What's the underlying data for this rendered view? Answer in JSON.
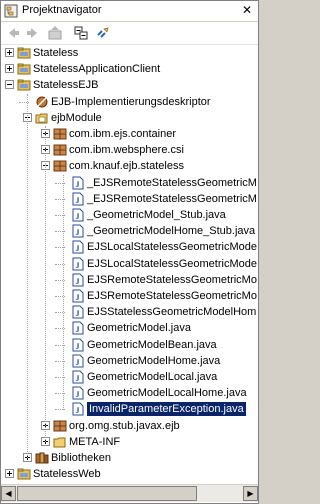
{
  "window": {
    "title": "Projektnavigator",
    "close_glyph": "✕"
  },
  "toolbar": {
    "buttons": [
      "back-arrow-icon",
      "forward-arrow-icon",
      "up-folder-icon",
      "collapse-all-icon",
      "link-editor-icon"
    ]
  },
  "tree": {
    "items": [
      {
        "label": "Stateless",
        "depth": 0,
        "expander": "plus",
        "icon": "project"
      },
      {
        "label": "StatelessApplicationClient",
        "depth": 0,
        "expander": "plus",
        "icon": "project"
      },
      {
        "label": "StatelessEJB",
        "depth": 0,
        "expander": "minus",
        "icon": "project"
      },
      {
        "label": "EJB-Implementierungsdeskriptor",
        "depth": 1,
        "expander": "none",
        "icon": "descriptor"
      },
      {
        "label": "ejbModule",
        "depth": 1,
        "expander": "minus",
        "icon": "source-folder"
      },
      {
        "label": "com.ibm.ejs.container",
        "depth": 2,
        "expander": "plus",
        "icon": "package"
      },
      {
        "label": "com.ibm.websphere.csi",
        "depth": 2,
        "expander": "plus",
        "icon": "package"
      },
      {
        "label": "com.knauf.ejb.stateless",
        "depth": 2,
        "expander": "minus",
        "icon": "package"
      },
      {
        "label": "_EJSRemoteStatelessGeometricM",
        "depth": 3,
        "expander": "none",
        "icon": "java"
      },
      {
        "label": "_EJSRemoteStatelessGeometricM",
        "depth": 3,
        "expander": "none",
        "icon": "java"
      },
      {
        "label": "_GeometricModel_Stub.java",
        "depth": 3,
        "expander": "none",
        "icon": "java"
      },
      {
        "label": "_GeometricModelHome_Stub.java",
        "depth": 3,
        "expander": "none",
        "icon": "java"
      },
      {
        "label": "EJSLocalStatelessGeometricMode",
        "depth": 3,
        "expander": "none",
        "icon": "java"
      },
      {
        "label": "EJSLocalStatelessGeometricMode",
        "depth": 3,
        "expander": "none",
        "icon": "java"
      },
      {
        "label": "EJSRemoteStatelessGeometricMo",
        "depth": 3,
        "expander": "none",
        "icon": "java"
      },
      {
        "label": "EJSRemoteStatelessGeometricMo",
        "depth": 3,
        "expander": "none",
        "icon": "java"
      },
      {
        "label": "EJSStatelessGeometricModelHom",
        "depth": 3,
        "expander": "none",
        "icon": "java"
      },
      {
        "label": "GeometricModel.java",
        "depth": 3,
        "expander": "none",
        "icon": "java"
      },
      {
        "label": "GeometricModelBean.java",
        "depth": 3,
        "expander": "none",
        "icon": "java"
      },
      {
        "label": "GeometricModelHome.java",
        "depth": 3,
        "expander": "none",
        "icon": "java"
      },
      {
        "label": "GeometricModelLocal.java",
        "depth": 3,
        "expander": "none",
        "icon": "java"
      },
      {
        "label": "GeometricModelLocalHome.java",
        "depth": 3,
        "expander": "none",
        "icon": "java"
      },
      {
        "label": "InvalidParameterException.java",
        "depth": 3,
        "expander": "none",
        "icon": "java",
        "selected": true
      },
      {
        "label": "org.omg.stub.javax.ejb",
        "depth": 2,
        "expander": "plus",
        "icon": "package"
      },
      {
        "label": "META-INF",
        "depth": 2,
        "expander": "plus",
        "icon": "folder"
      },
      {
        "label": "Bibliotheken",
        "depth": 1,
        "expander": "plus",
        "icon": "library"
      },
      {
        "label": "StatelessWeb",
        "depth": 0,
        "expander": "plus",
        "icon": "project"
      }
    ]
  },
  "colors": {
    "selection": "#0a246a",
    "folder": "#e8c060",
    "package": "#b87333"
  }
}
